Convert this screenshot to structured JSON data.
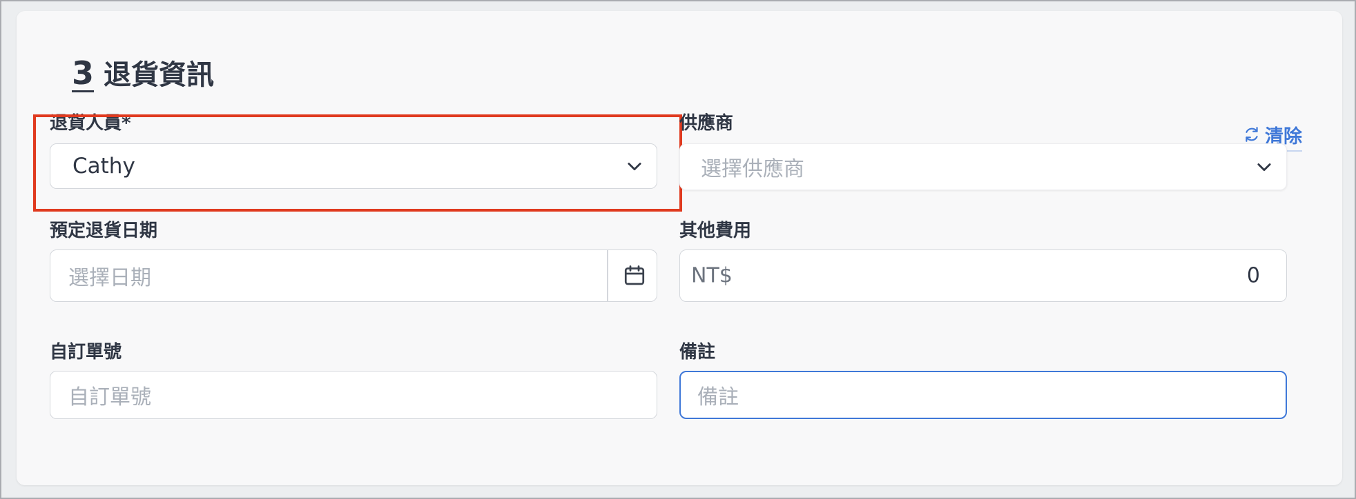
{
  "section": {
    "number": "3",
    "title": "退貨資訊"
  },
  "fields": {
    "return_staff": {
      "label": "退貨人員*",
      "value": "Cathy"
    },
    "supplier": {
      "label": "供應商",
      "placeholder": "選擇供應商",
      "clear_label": "清除"
    },
    "scheduled_date": {
      "label": "預定退貨日期",
      "placeholder": "選擇日期"
    },
    "other_fees": {
      "label": "其他費用",
      "prefix": "NT$",
      "value": "0"
    },
    "custom_number": {
      "label": "自訂單號",
      "placeholder": "自訂單號"
    },
    "notes": {
      "label": "備註",
      "placeholder": "備註"
    }
  },
  "colors": {
    "highlight": "#e03a1f",
    "accent": "#3f78d8"
  },
  "icons": [
    "chevron-down-icon",
    "refresh-icon",
    "calendar-icon"
  ]
}
